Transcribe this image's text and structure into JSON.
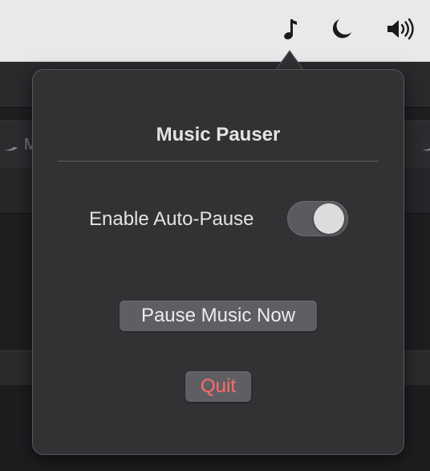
{
  "menubar": {
    "items": [
      {
        "icon": "music-note-icon"
      },
      {
        "icon": "moon-icon"
      },
      {
        "icon": "speaker-volume-icon"
      }
    ]
  },
  "background_window": {
    "toolbar_label": "Mu",
    "tab_label": "M"
  },
  "popover": {
    "title": "Music Pauser",
    "auto_pause": {
      "label": "Enable Auto-Pause",
      "enabled": false
    },
    "pause_button_label": "Pause Music Now",
    "quit_button_label": "Quit"
  },
  "colors": {
    "popover_background": "#323235",
    "button_background": "#5f5f63",
    "quit_text": "#ff6b6b",
    "menubar_background": "#e9e9eb"
  }
}
